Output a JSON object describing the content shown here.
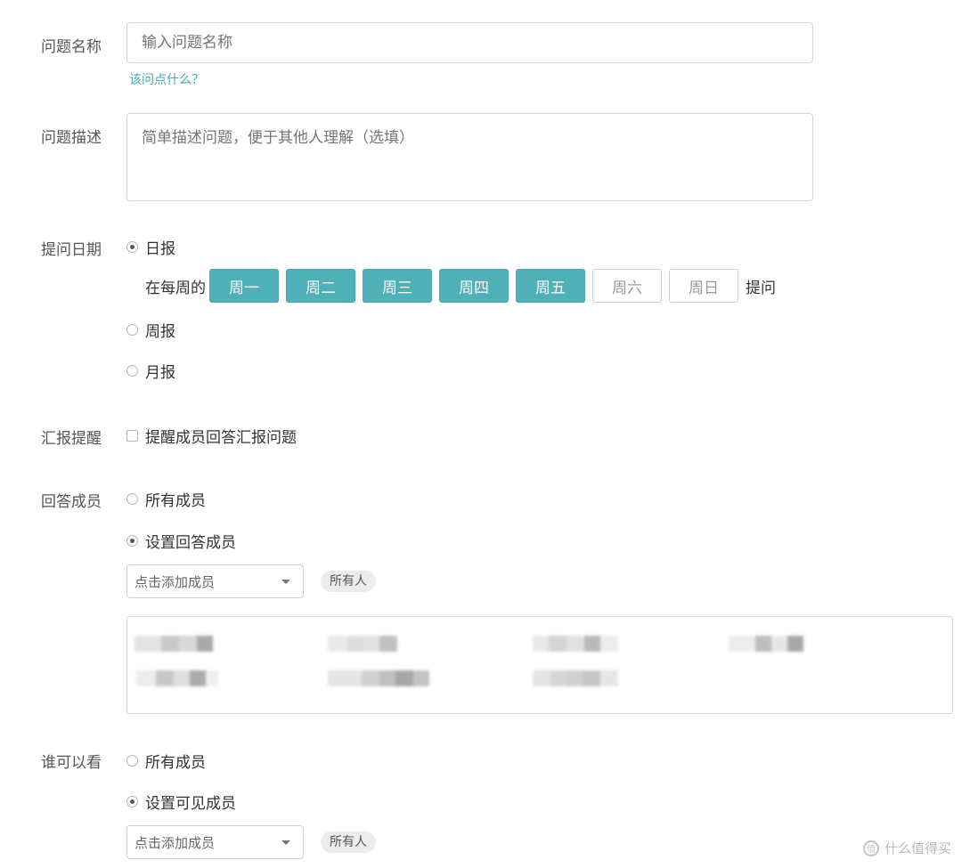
{
  "fields": {
    "name_label": "问题名称",
    "name_placeholder": "输入问题名称",
    "name_hint": "该问点什么？",
    "desc_label": "问题描述",
    "desc_placeholder": "简单描述问题，便于其他人理解（选填）",
    "date_label": "提问日期",
    "remind_label": "汇报提醒",
    "answer_label": "回答成员",
    "visible_label": "谁可以看"
  },
  "schedule": {
    "daily": "日报",
    "weekly": "周报",
    "monthly": "月报",
    "selected": "daily",
    "prefix": "在每周的",
    "suffix": "提问",
    "days": [
      {
        "label": "周一",
        "selected": true
      },
      {
        "label": "周二",
        "selected": true
      },
      {
        "label": "周三",
        "selected": true
      },
      {
        "label": "周四",
        "selected": true
      },
      {
        "label": "周五",
        "selected": true
      },
      {
        "label": "周六",
        "selected": false
      },
      {
        "label": "周日",
        "selected": false
      }
    ]
  },
  "reminder": {
    "checkbox_label": "提醒成员回答汇报问题",
    "checked": false
  },
  "answer": {
    "all": "所有成员",
    "custom": "设置回答成员",
    "selected": "custom",
    "add_placeholder": "点击添加成员",
    "tag": "所有人"
  },
  "visibility": {
    "all": "所有成员",
    "custom": "设置可见成员",
    "selected": "custom",
    "add_placeholder": "点击添加成员",
    "tag": "所有人"
  },
  "watermark": "什么值得买",
  "colors": {
    "accent": "#4fb0b7",
    "hint": "#4aa7b0"
  }
}
